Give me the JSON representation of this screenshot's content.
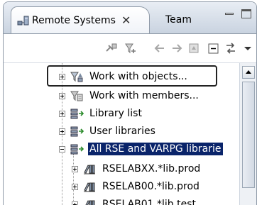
{
  "tabs": {
    "active_label": "Remote Systems",
    "close_glyph": "✕",
    "inactive_label": "Team"
  },
  "toolbar": {
    "icons": [
      "connect-icon",
      "refine-icon",
      "back-icon",
      "forward-icon",
      "home-icon",
      "collapse-all-icon",
      "link-with-editor-icon",
      "view-menu-icon"
    ]
  },
  "tree": {
    "items": [
      {
        "label": "Work with objects...",
        "icon": "filter-work-objects-icon",
        "expanded": false
      },
      {
        "label": "Work with members...",
        "icon": "filter-work-members-icon",
        "expanded": false
      },
      {
        "label": "Library list",
        "icon": "library-list-icon",
        "expanded": false
      },
      {
        "label": "User libraries",
        "icon": "user-libraries-icon",
        "expanded": false
      },
      {
        "label": "All RSE and VARPG librarie",
        "icon": "library-filter-icon",
        "expanded": true,
        "selected": true
      },
      {
        "label": "RSELABXX.*lib.prod",
        "icon": "library-icon",
        "expanded": false
      },
      {
        "label": "RSELAB00.*lib.prod",
        "icon": "library-icon",
        "expanded": false
      },
      {
        "label": "RSELAB01.*lib.test",
        "icon": "library-icon",
        "expanded": false
      }
    ]
  },
  "colors": {
    "selection": "#0a246a",
    "frame": "#8f9aa8"
  }
}
